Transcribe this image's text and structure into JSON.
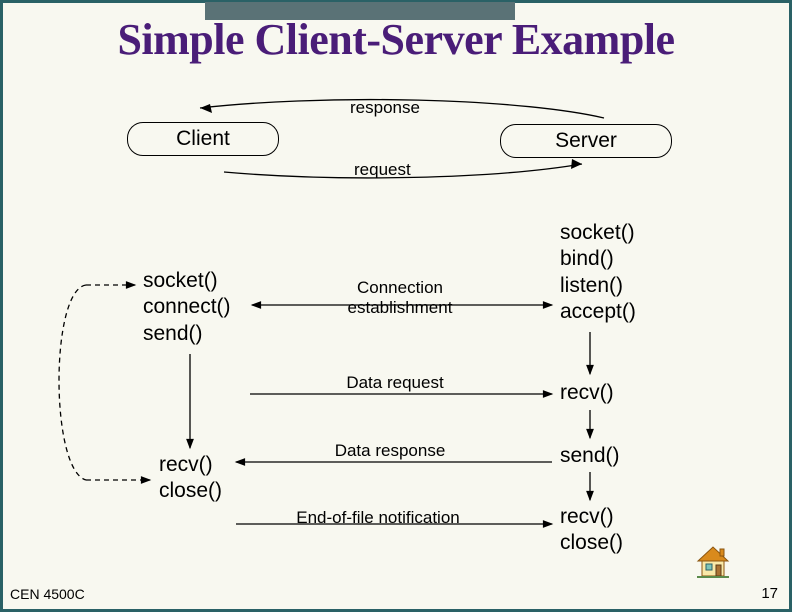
{
  "title": "Simple Client-Server Example",
  "nodes": {
    "client": "Client",
    "server": "Server"
  },
  "top_labels": {
    "response": "response",
    "request": "request"
  },
  "client": {
    "top_fns": [
      "socket()",
      "connect()",
      "send()"
    ],
    "bottom_fns": [
      "recv()",
      "close()"
    ]
  },
  "server": {
    "top_fns": [
      "socket()",
      "bind()",
      "listen()",
      "accept()"
    ],
    "recv1": "recv()",
    "send": "send()",
    "bottom_fns": [
      "recv()",
      "close()"
    ]
  },
  "mid_labels": {
    "conn_est": [
      "Connection",
      "establishment"
    ],
    "data_req": "Data request",
    "data_resp": "Data response",
    "eof_notif": "End-of-file notification"
  },
  "footer": {
    "left": "CEN 4500C",
    "right": "17"
  },
  "icon": {
    "name": "house-icon"
  }
}
